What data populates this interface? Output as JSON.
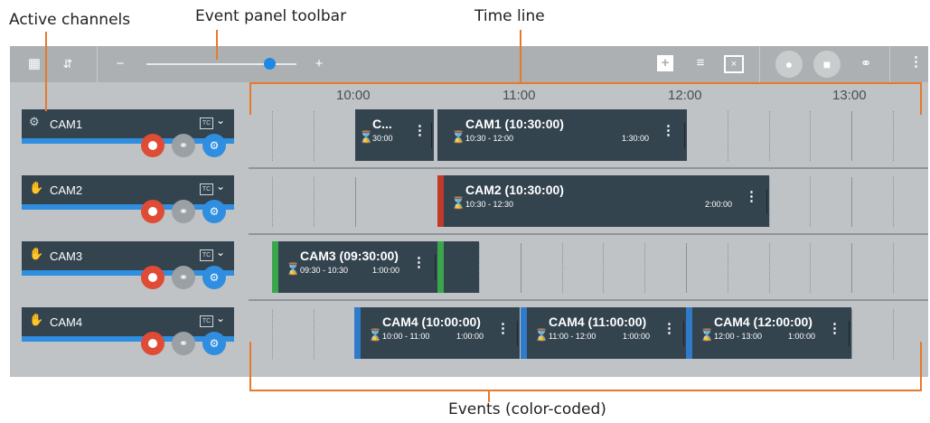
{
  "annotations": {
    "active_channels": "Active channels",
    "toolbar": "Event panel toolbar",
    "timeline": "Time line",
    "events": "Events (color-coded)"
  },
  "toolbar": {
    "icons": [
      "channel-layout-icon",
      "expand-collapse-icon",
      "zoom-out-icon",
      "zoom-in-icon",
      "add-event-icon",
      "filter-icon",
      "calendar-clear-icon",
      "record-all-icon",
      "stop-all-icon",
      "link-icon",
      "more-icon"
    ],
    "zoom_level": 0.8
  },
  "timeline": {
    "ticks": [
      "10:00",
      "11:00",
      "12:00",
      "13:00"
    ]
  },
  "channels": [
    {
      "name": "CAM1",
      "icon": "wireless-antenna-icon",
      "tc": "TC"
    },
    {
      "name": "CAM2",
      "icon": "hand-icon",
      "tc": "TC"
    },
    {
      "name": "CAM3",
      "icon": "hand-icon",
      "tc": "TC"
    },
    {
      "name": "CAM4",
      "icon": "hand-icon",
      "tc": "TC"
    }
  ],
  "events": {
    "cam1": [
      {
        "title": "C...",
        "range": "",
        "duration": "30:00",
        "color": "#34444f"
      },
      {
        "title": "CAM1 (10:30:00)",
        "range": "10:30 - 12:00",
        "duration": "1:30:00",
        "color": "#34444f"
      }
    ],
    "cam2": [
      {
        "title": "CAM2 (10:30:00)",
        "range": "10:30 - 12:30",
        "duration": "2:00:00",
        "color": "#c0392b"
      }
    ],
    "cam3": [
      {
        "title": "CAM3 (09:30:00)",
        "range": "09:30 - 10:30",
        "duration": "1:00:00",
        "color": "#3aa64c"
      }
    ],
    "cam4": [
      {
        "title": "CAM4 (10:00:00)",
        "range": "10:00 - 11:00",
        "duration": "1:00:00",
        "color": "#2f7ac9"
      },
      {
        "title": "CAM4 (11:00:00)",
        "range": "11:00 - 12:00",
        "duration": "1:00:00",
        "color": "#2f7ac9"
      },
      {
        "title": "CAM4 (12:00:00)",
        "range": "12:00 - 13:00",
        "duration": "1:00:00",
        "color": "#2f7ac9"
      }
    ]
  }
}
